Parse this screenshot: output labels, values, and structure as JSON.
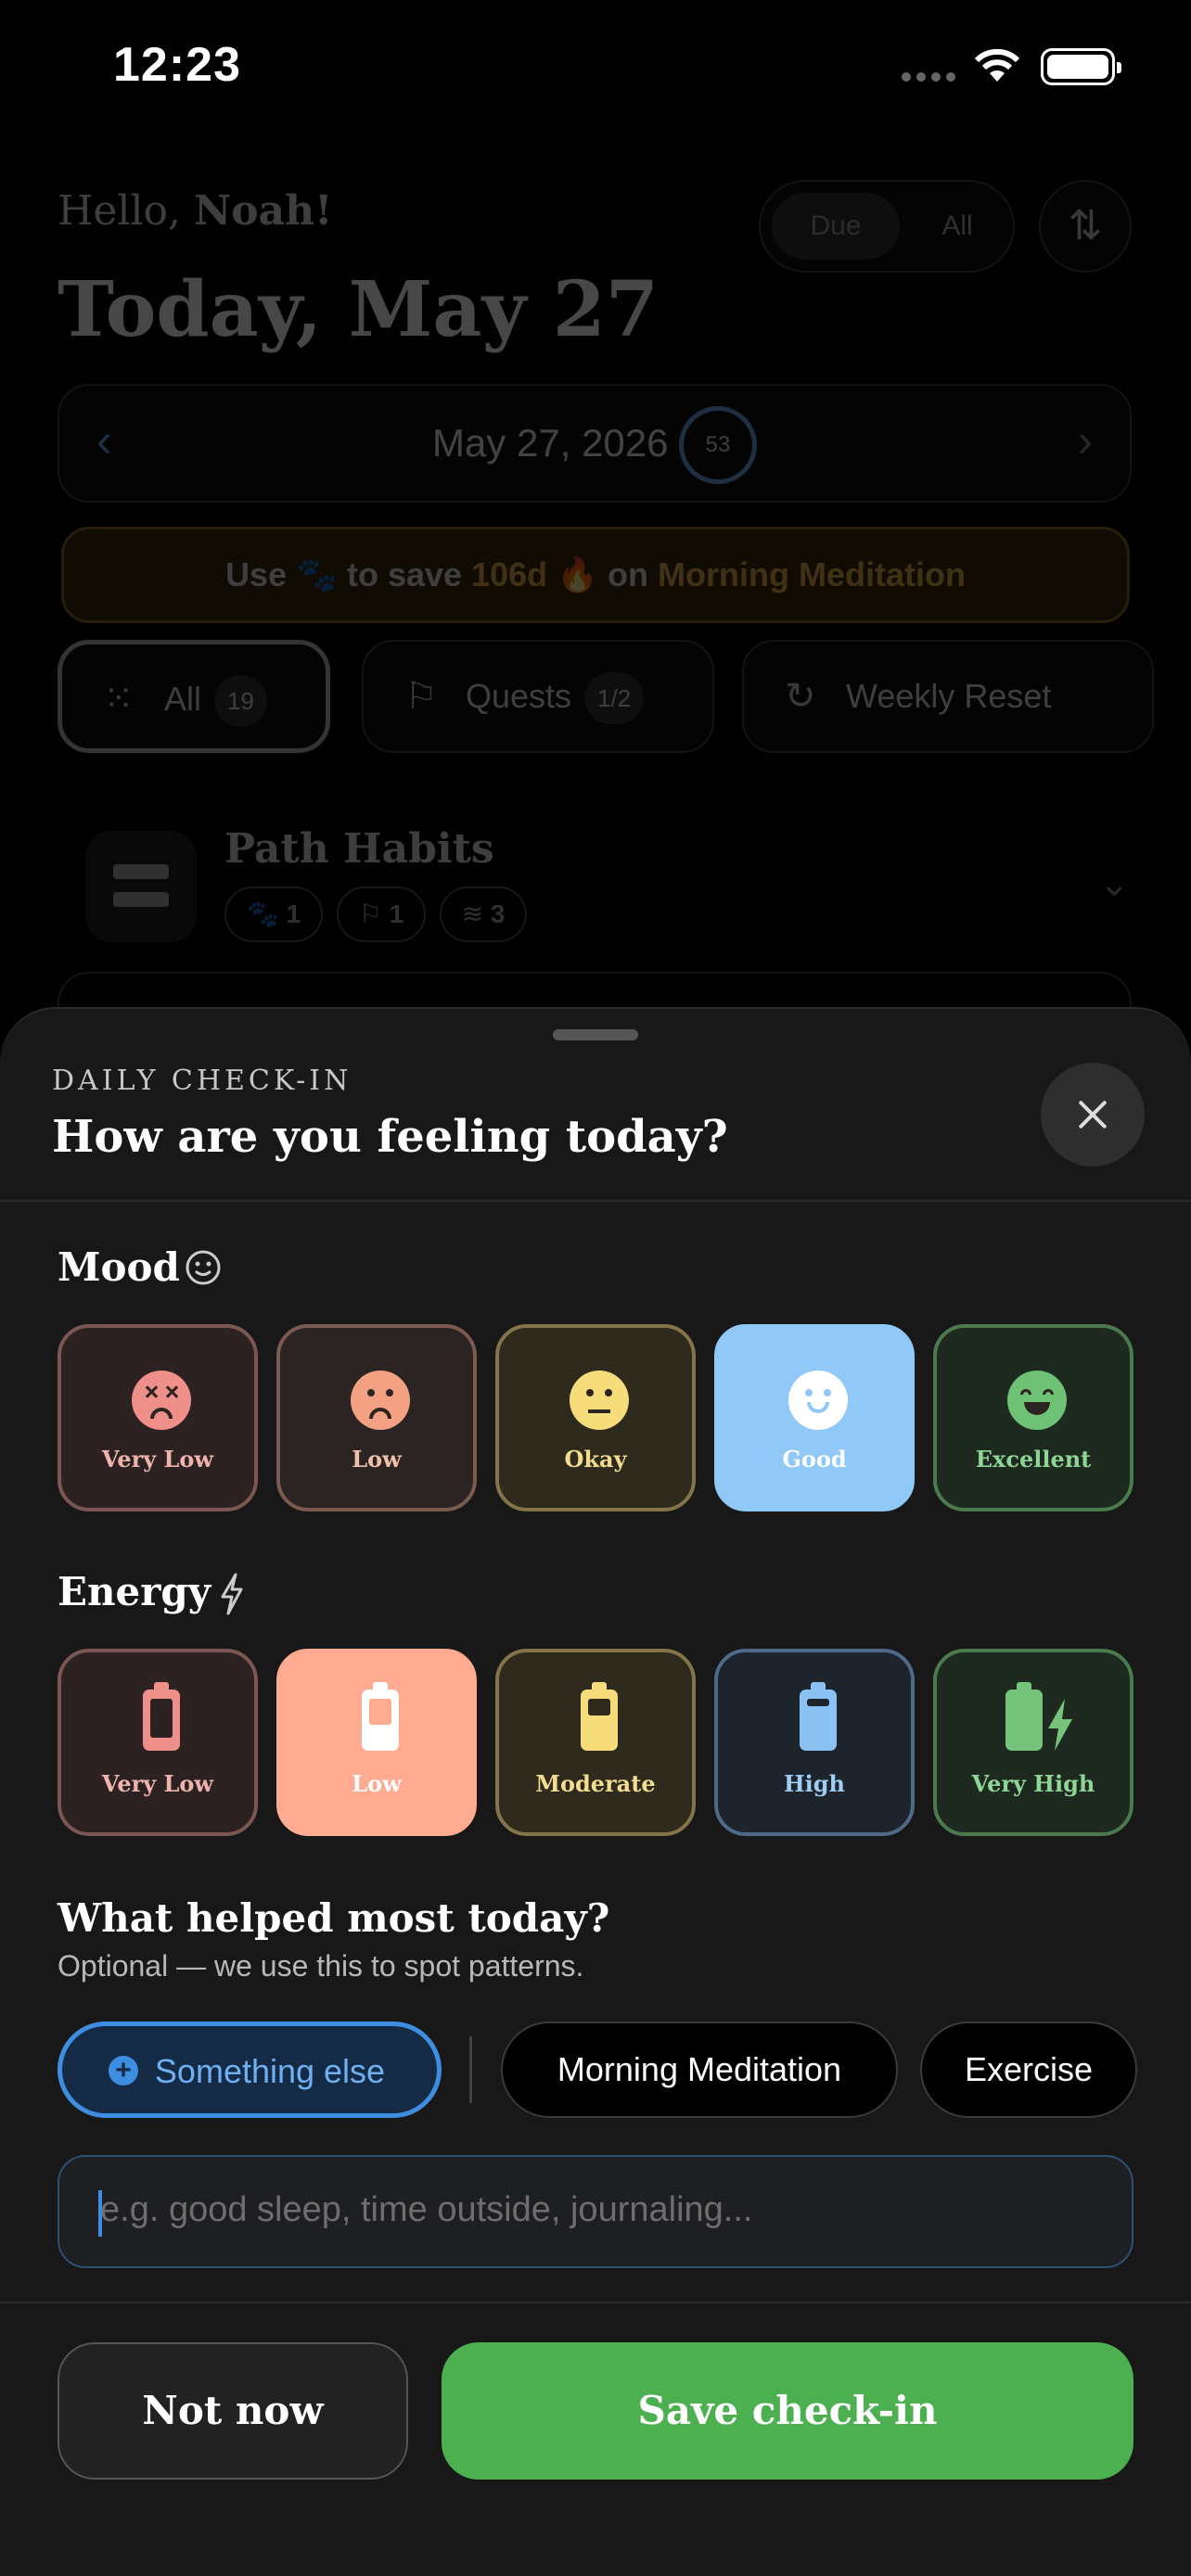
{
  "status_bar": {
    "time": "12:23"
  },
  "background": {
    "greeting_prefix": "Hello,",
    "greeting_name": "Noah!",
    "filter": {
      "due": "Due",
      "all": "All"
    },
    "title": "Today, May 27",
    "date_label": "May 27, 2026",
    "date_progress": "53",
    "banner": {
      "use": "Use",
      "to_save": "to save",
      "days": "106d",
      "on": "on",
      "habit": "Morning Meditation"
    },
    "chips": [
      {
        "label": "All",
        "count": "19"
      },
      {
        "label": "Quests",
        "count": "1/2"
      },
      {
        "label": "Weekly Reset",
        "count": ""
      }
    ],
    "path": {
      "title": "Path Habits",
      "pills": [
        "1",
        "1",
        "3"
      ]
    }
  },
  "sheet": {
    "eyebrow": "DAILY CHECK-IN",
    "title": "How are you feeling today?",
    "mood": {
      "title": "Mood",
      "selected": "Good",
      "options": [
        "Very Low",
        "Low",
        "Okay",
        "Good",
        "Excellent"
      ]
    },
    "energy": {
      "title": "Energy",
      "selected": "Low",
      "options": [
        "Very Low",
        "Low",
        "Moderate",
        "High",
        "Very High"
      ]
    },
    "helped": {
      "title": "What helped most today?",
      "subtitle": "Optional — we use this to spot patterns.",
      "chips": [
        "Something else",
        "Morning Meditation",
        "Exercise"
      ],
      "selected": "Something else"
    },
    "note_placeholder": "e.g. good sleep, time outside, journaling...",
    "buttons": {
      "dismiss": "Not now",
      "save": "Save check-in"
    }
  },
  "colors": {
    "accent_blue": "#3d8ee0",
    "save_green": "#4caf50",
    "mood_good_selected": "#90c8f8",
    "energy_low_selected": "#ffab91"
  }
}
